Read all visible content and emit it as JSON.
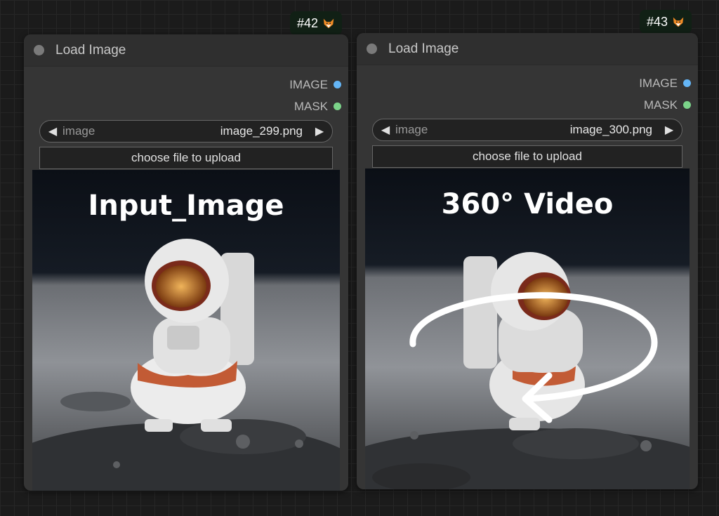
{
  "nodes": [
    {
      "id_label": "#42",
      "title": "Load Image",
      "outputs": [
        {
          "label": "IMAGE",
          "color": "#64b5f6"
        },
        {
          "label": "MASK",
          "color": "#7bd389"
        }
      ],
      "combo": {
        "label": "image",
        "value": "image_299.png"
      },
      "upload_label": "choose file to upload",
      "preview_caption": "Input_Image"
    },
    {
      "id_label": "#43",
      "title": "Load Image",
      "outputs": [
        {
          "label": "IMAGE",
          "color": "#64b5f6"
        },
        {
          "label": "MASK",
          "color": "#7bd389"
        }
      ],
      "combo": {
        "label": "image",
        "value": "image_300.png"
      },
      "upload_label": "choose file to upload",
      "preview_caption": "360° Video"
    }
  ],
  "icons": {
    "badge": "fox-icon",
    "combo_left": "triangle-left-icon",
    "combo_right": "triangle-right-icon"
  }
}
